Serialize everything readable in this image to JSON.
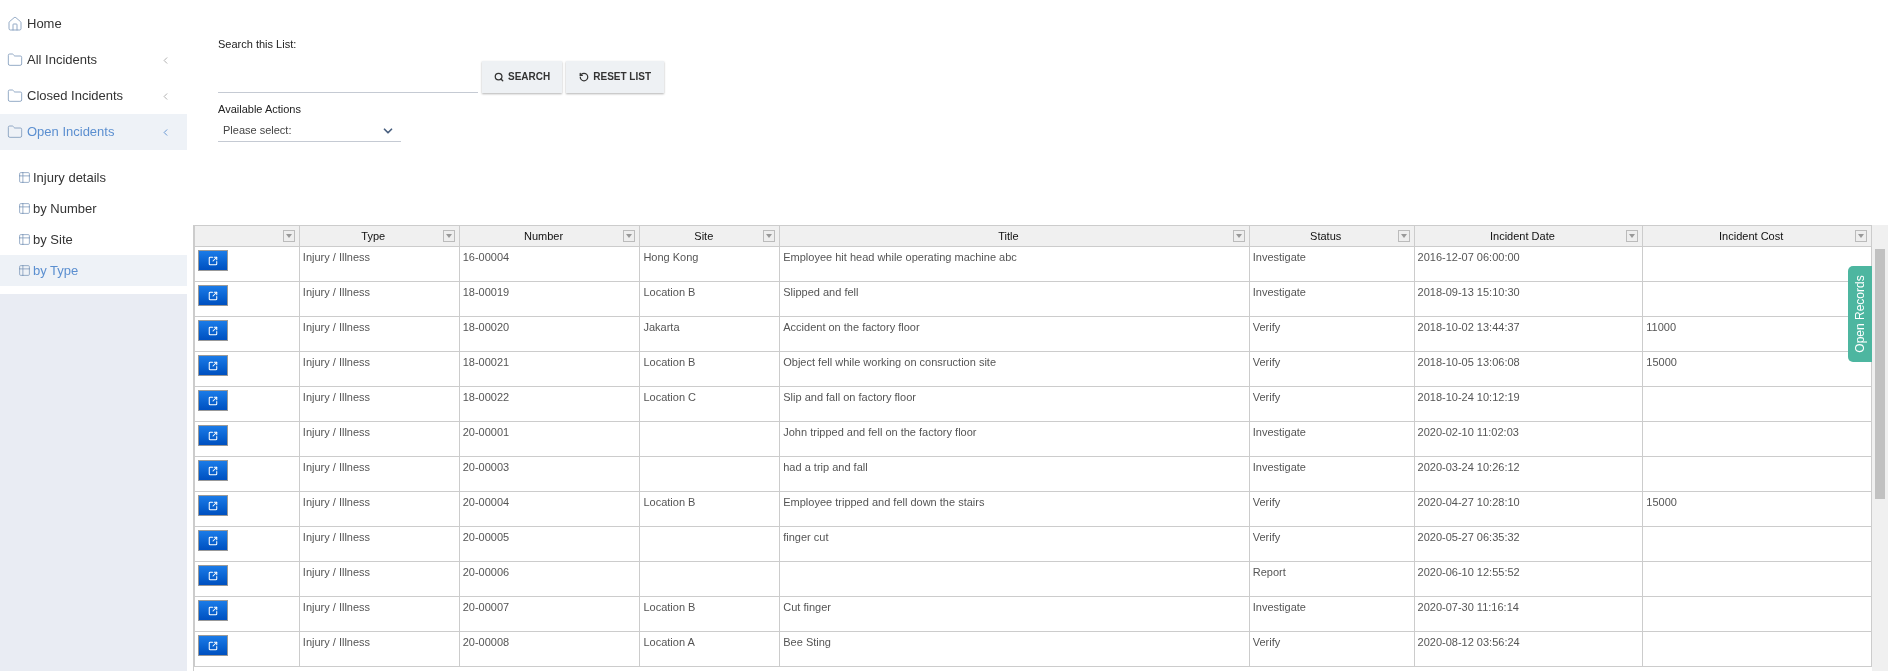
{
  "sidebar": {
    "items": [
      {
        "kind": "home",
        "label": "Home",
        "selected": false
      },
      {
        "kind": "folder",
        "label": "All Incidents",
        "selected": false,
        "expanded": false
      },
      {
        "kind": "folder",
        "label": "Closed Incidents",
        "selected": false,
        "expanded": false
      },
      {
        "kind": "folder",
        "label": "Open Incidents",
        "selected": true,
        "expanded": true,
        "children": [
          {
            "label": "Injury details",
            "selected": false
          },
          {
            "label": "by Number",
            "selected": false
          },
          {
            "label": "by Site",
            "selected": false
          },
          {
            "label": "by Type",
            "selected": true
          }
        ]
      }
    ]
  },
  "search": {
    "label": "Search this List:",
    "search_button": "SEARCH",
    "reset_button": "RESET LIST"
  },
  "actions": {
    "label": "Available Actions",
    "placeholder": "Please select:"
  },
  "table": {
    "columns": [
      "",
      "Type",
      "Number",
      "Site",
      "Title",
      "Status",
      "Incident Date",
      "Incident Cost"
    ],
    "rows": [
      [
        "",
        "Injury / Illness",
        "16-00004",
        "Hong Kong",
        "Employee hit head while operating machine abc",
        "Investigate",
        "2016-12-07 06:00:00",
        ""
      ],
      [
        "",
        "Injury / Illness",
        "18-00019",
        "Location B",
        "Slipped and fell",
        "Investigate",
        "2018-09-13 15:10:30",
        ""
      ],
      [
        "",
        "Injury / Illness",
        "18-00020",
        "Jakarta",
        "Accident on the factory floor",
        "Verify",
        "2018-10-02 13:44:37",
        "11000"
      ],
      [
        "",
        "Injury / Illness",
        "18-00021",
        "Location B",
        "Object fell while working on consruction site",
        "Verify",
        "2018-10-05 13:06:08",
        "15000"
      ],
      [
        "",
        "Injury / Illness",
        "18-00022",
        "Location C",
        "Slip and fall on factory floor",
        "Verify",
        "2018-10-24 10:12:19",
        ""
      ],
      [
        "",
        "Injury / Illness",
        "20-00001",
        "",
        "John tripped and fell on the factory floor",
        "Investigate",
        "2020-02-10 11:02:03",
        ""
      ],
      [
        "",
        "Injury / Illness",
        "20-00003",
        "",
        "had a trip and fall",
        "Investigate",
        "2020-03-24 10:26:12",
        ""
      ],
      [
        "",
        "Injury / Illness",
        "20-00004",
        "Location B",
        "Employee tripped and fell down the stairs",
        "Verify",
        "2020-04-27 10:28:10",
        "15000"
      ],
      [
        "",
        "Injury / Illness",
        "20-00005",
        "",
        "finger cut",
        "Verify",
        "2020-05-27 06:35:32",
        ""
      ],
      [
        "",
        "Injury / Illness",
        "20-00006",
        "",
        "",
        "Report",
        "2020-06-10 12:55:52",
        ""
      ],
      [
        "",
        "Injury / Illness",
        "20-00007",
        "Location B",
        "Cut finger",
        "Investigate",
        "2020-07-30 11:16:14",
        ""
      ],
      [
        "",
        "Injury / Illness",
        "20-00008",
        "Location A",
        "Bee Sting",
        "Verify",
        "2020-08-12 03:56:24",
        ""
      ]
    ]
  },
  "side_tab": {
    "label": "Open Records"
  }
}
